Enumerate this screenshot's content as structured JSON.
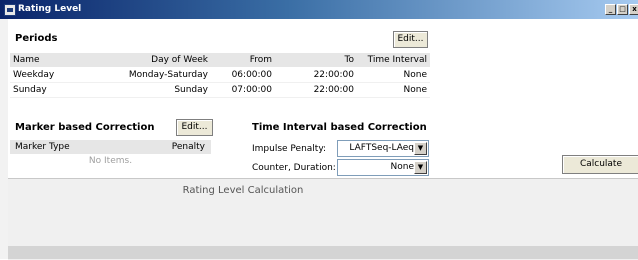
{
  "window": {
    "title": "Rating Level",
    "controls": [
      "_",
      "□",
      "x"
    ]
  },
  "periods": {
    "heading": "Periods",
    "edit_label": "Edit...",
    "columns": [
      "Name",
      "Day of Week",
      "From",
      "To",
      "Time Interval"
    ],
    "rows": [
      [
        "Weekday",
        "Monday-Saturday",
        "06:00:00",
        "22:00:00",
        "None"
      ],
      [
        "Sunday",
        "Sunday",
        "07:00:00",
        "22:00:00",
        "None"
      ]
    ]
  },
  "marker": {
    "heading": "Marker based Correction",
    "edit_label": "Edit...",
    "columns": [
      "Marker Type",
      "Penalty"
    ],
    "empty_text": "No Items."
  },
  "time_interval": {
    "heading": "Time Interval based Correction",
    "impulse_label": "Impulse Penalty:",
    "impulse_value": "LAFTSeq-LAeq",
    "counter_label": "Counter, Duration:",
    "counter_value": "None"
  },
  "calculate_label": "Calculate",
  "calculation_title": "Rating Level Calculation"
}
